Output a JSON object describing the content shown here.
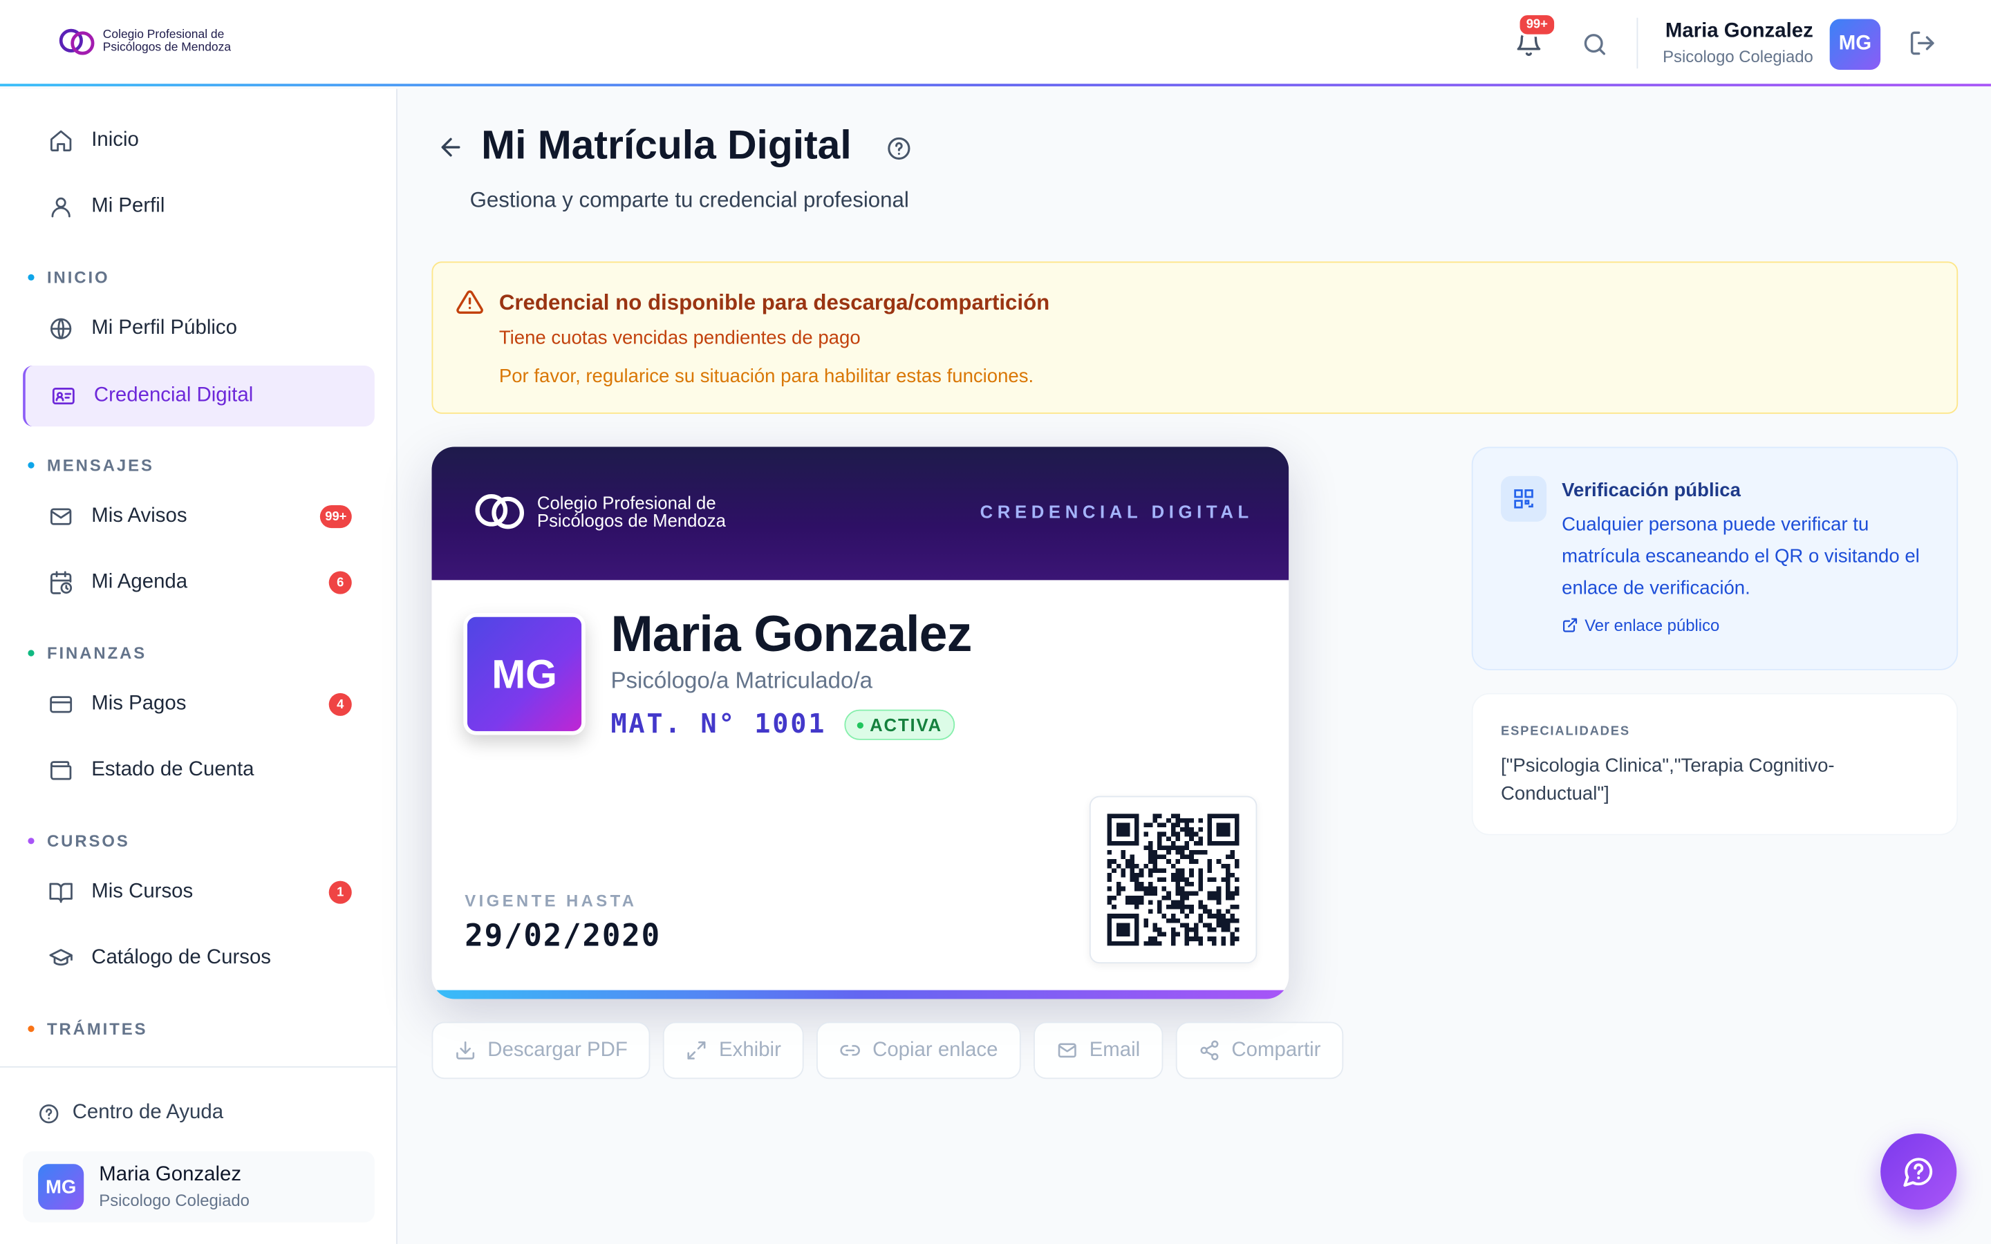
{
  "brand": {
    "line1": "Colegio Profesional de",
    "line2": "Psicólogos de Mendoza"
  },
  "header": {
    "notifications_badge": "99+",
    "user_name": "Maria Gonzalez",
    "user_role": "Psicologo Colegiado",
    "user_initials": "MG"
  },
  "sidebar": {
    "items": [
      {
        "label": "Inicio",
        "icon": "home-icon"
      },
      {
        "label": "Mi Perfil",
        "icon": "user-icon"
      },
      {
        "label": "Mi Perfil Público",
        "icon": "globe-icon"
      },
      {
        "label": "Credencial Digital",
        "icon": "id-card-icon",
        "active": true
      },
      {
        "label": "Mis Avisos",
        "icon": "mail-icon",
        "badge": "99+"
      },
      {
        "label": "Mi Agenda",
        "icon": "calendar-clock-icon",
        "badge": "6"
      },
      {
        "label": "Mis Pagos",
        "icon": "credit-card-icon",
        "badge": "4"
      },
      {
        "label": "Estado de Cuenta",
        "icon": "wallet-icon"
      },
      {
        "label": "Mis Cursos",
        "icon": "book-open-icon",
        "badge": "1"
      },
      {
        "label": "Catálogo de Cursos",
        "icon": "graduation-cap-icon"
      }
    ],
    "sections": {
      "inicio": {
        "label": "INICIO",
        "color": "#0ea5e9"
      },
      "mensajes": {
        "label": "MENSAJES",
        "color": "#0ea5e9"
      },
      "finanzas": {
        "label": "FINANZAS",
        "color": "#10b981"
      },
      "cursos": {
        "label": "CURSOS",
        "color": "#a855f7"
      },
      "tramites": {
        "label": "TRÁMITES",
        "color": "#f97316"
      }
    },
    "help": "Centro de Ayuda",
    "user_name": "Maria Gonzalez",
    "user_role": "Psicologo Colegiado",
    "user_initials": "MG"
  },
  "page": {
    "title": "Mi Matrícula Digital",
    "subtitle": "Gestiona y comparte tu credencial profesional"
  },
  "alert": {
    "title": "Credencial no disponible para descarga/compartición",
    "line1": "Tiene cuotas vencidas pendientes de pago",
    "line2": "Por favor, regularice su situación para habilitar estas funciones."
  },
  "credential": {
    "label": "CREDENCIAL DIGITAL",
    "initials": "MG",
    "name": "Maria Gonzalez",
    "role": "Psicólogo/a Matriculado/a",
    "matricula": "MAT. N° 1001",
    "status": "ACTIVA",
    "valid_label": "VIGENTE HASTA",
    "valid_date": "29/02/2020"
  },
  "actions": {
    "download": "Descargar PDF",
    "show": "Exhibir",
    "copy": "Copiar enlace",
    "email": "Email",
    "share": "Compartir"
  },
  "verify": {
    "title": "Verificación pública",
    "text": "Cualquier persona puede verificar tu matrícula escaneando el QR o visitando el enlace de verificación.",
    "link": "Ver enlace público"
  },
  "specialties": {
    "label": "ESPECIALIDADES",
    "value": "[\"Psicologia Clinica\",\"Terapia Cognitivo-Conductual\"]"
  },
  "colors": {
    "accent": "#7c3aed",
    "danger": "#ef4444",
    "card_header": "#1e1b4b"
  }
}
